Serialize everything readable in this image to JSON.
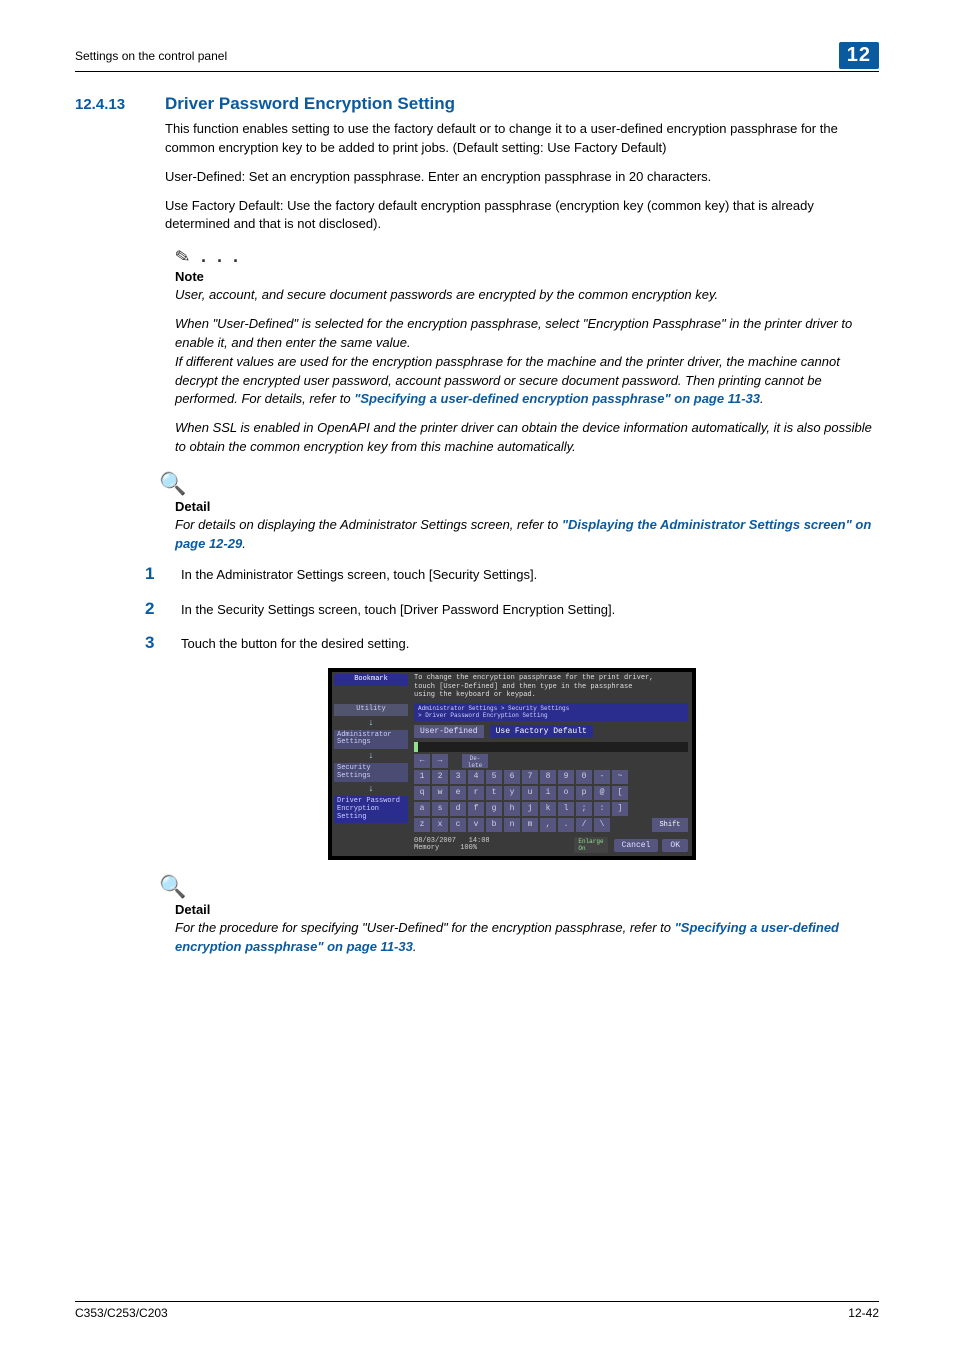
{
  "header": {
    "breadcrumb": "Settings on the control panel",
    "chapter_badge": "12"
  },
  "section": {
    "number": "12.4.13",
    "title": "Driver Password Encryption Setting"
  },
  "paras": {
    "p1": "This function enables setting to use the factory default or to change it to a user-defined encryption passphrase for the common encryption key to be added to print jobs. (Default setting: Use Factory Default)",
    "p2": "User-Defined: Set an encryption passphrase. Enter an encryption passphrase in 20 characters.",
    "p3": "Use Factory Default: Use the factory default encryption passphrase (encryption key (common key) that is already determined and that is not disclosed)."
  },
  "note": {
    "head": "Note",
    "n1": "User, account, and secure document passwords are encrypted by the common encryption key.",
    "n2a": "When \"User-Defined\" is selected for the encryption passphrase, select \"Encryption Passphrase\" in the printer driver to enable it, and then enter the same value.",
    "n2b_pre": "If different values are used for the encryption passphrase for the machine and the printer driver, the machine cannot decrypt the encrypted user password, account password or secure document password. Then printing cannot be performed. For details, refer to ",
    "n2b_link": "\"Specifying a user-defined encryption passphrase\" on page 11-33",
    "n2b_post": ".",
    "n3": "When SSL is enabled in OpenAPI and the printer driver can obtain the device information automatically, it is also possible to obtain the common encryption key from this machine automatically."
  },
  "detail1": {
    "head": "Detail",
    "pre": "For details on displaying the Administrator Settings screen, refer to ",
    "link": "\"Displaying the Administrator Settings screen\" on page 12-29",
    "post": "."
  },
  "steps": {
    "s1": "In the Administrator Settings screen, touch [Security Settings].",
    "s2": "In the Security Settings screen, touch [Driver Password Encryption Setting].",
    "s3": "Touch the button for the desired setting."
  },
  "panel": {
    "msg": "To change the encryption passphrase for the print driver,\ntouch [User-Defined] and then type in the passphrase\nusing the keyboard or keypad.",
    "crumb": "Administrator Settings > Security Settings\n> Driver Password Encryption Setting",
    "side": {
      "bookmark": "Bookmark",
      "utility": "Utility",
      "admin": "Administrator\nSettings",
      "security": "Security\nSettings",
      "driver": "Driver Password\nEncryption\nSetting"
    },
    "tabs": {
      "userdef": "User-Defined",
      "factory": "Use Factory Default"
    },
    "arrows": {
      "left": "←",
      "right": "→",
      "del": "De-\nlete"
    },
    "rows": {
      "r1": [
        "1",
        "2",
        "3",
        "4",
        "5",
        "6",
        "7",
        "8",
        "9",
        "0",
        "-",
        "~"
      ],
      "r2": [
        "q",
        "w",
        "e",
        "r",
        "t",
        "y",
        "u",
        "i",
        "o",
        "p",
        "@",
        "["
      ],
      "r3": [
        "a",
        "s",
        "d",
        "f",
        "g",
        "h",
        "j",
        "k",
        "l",
        ";",
        ":",
        "]"
      ],
      "r4": [
        "z",
        "x",
        "c",
        "v",
        "b",
        "n",
        "m",
        ",",
        ".",
        "/",
        "\\"
      ]
    },
    "shift": "Shift",
    "foot": {
      "date": "08/03/2007",
      "time": "14:08",
      "memory_label": "Memory",
      "memory_val": "100%",
      "enlarge": "Enlarge\nOn",
      "cancel": "Cancel",
      "ok": "OK"
    }
  },
  "detail2": {
    "head": "Detail",
    "pre": "For the procedure for specifying \"User-Defined\" for the encryption passphrase, refer to ",
    "link": "\"Specifying a user-defined encryption passphrase\" on page 11-33",
    "post": "."
  },
  "footer": {
    "model": "C353/C253/C203",
    "pageno": "12-42"
  }
}
